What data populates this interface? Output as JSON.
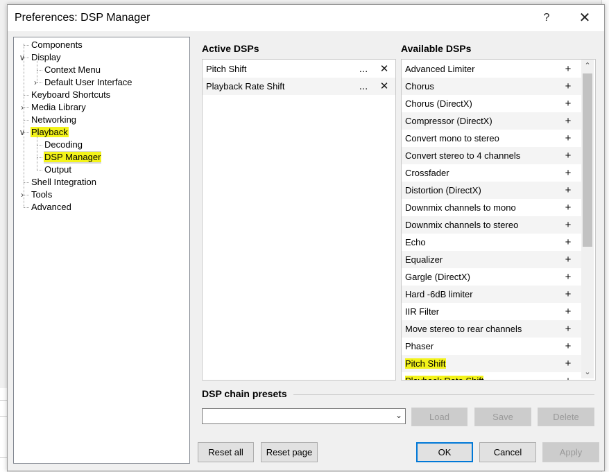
{
  "window": {
    "title": "Preferences: DSP Manager",
    "help_glyph": "?",
    "close_glyph": "✕"
  },
  "tree": {
    "items": [
      {
        "label": "Components",
        "highlight": false,
        "selected": false
      },
      {
        "label": "Display",
        "highlight": false,
        "selected": false,
        "expander": "expanded"
      },
      {
        "label": "Context Menu",
        "highlight": false,
        "selected": false
      },
      {
        "label": "Default User Interface",
        "highlight": false,
        "selected": false,
        "expander": "collapsed"
      },
      {
        "label": "Keyboard Shortcuts",
        "highlight": false,
        "selected": false
      },
      {
        "label": "Media Library",
        "highlight": false,
        "selected": false,
        "expander": "collapsed"
      },
      {
        "label": "Networking",
        "highlight": false,
        "selected": false
      },
      {
        "label": "Playback",
        "highlight": true,
        "selected": false,
        "expander": "expanded"
      },
      {
        "label": "Decoding",
        "highlight": false,
        "selected": false
      },
      {
        "label": "DSP Manager",
        "highlight": true,
        "selected": true
      },
      {
        "label": "Output",
        "highlight": false,
        "selected": false
      },
      {
        "label": "Shell Integration",
        "highlight": false,
        "selected": false
      },
      {
        "label": "Tools",
        "highlight": false,
        "selected": false,
        "expander": "collapsed"
      },
      {
        "label": "Advanced",
        "highlight": false,
        "selected": false
      }
    ]
  },
  "active": {
    "title": "Active DSPs",
    "configure_glyph": "...",
    "remove_glyph": "✕",
    "items": [
      {
        "label": "Pitch Shift"
      },
      {
        "label": "Playback Rate Shift"
      }
    ]
  },
  "available": {
    "title": "Available DSPs",
    "add_glyph": "+",
    "items": [
      {
        "label": "Advanced Limiter",
        "highlight": false
      },
      {
        "label": "Chorus",
        "highlight": false
      },
      {
        "label": "Chorus (DirectX)",
        "highlight": false
      },
      {
        "label": "Compressor (DirectX)",
        "highlight": false
      },
      {
        "label": "Convert mono to stereo",
        "highlight": false
      },
      {
        "label": "Convert stereo to 4 channels",
        "highlight": false
      },
      {
        "label": "Crossfader",
        "highlight": false
      },
      {
        "label": "Distortion (DirectX)",
        "highlight": false
      },
      {
        "label": "Downmix channels to mono",
        "highlight": false
      },
      {
        "label": "Downmix channels to stereo",
        "highlight": false
      },
      {
        "label": "Echo",
        "highlight": false
      },
      {
        "label": "Equalizer",
        "highlight": false
      },
      {
        "label": "Gargle (DirectX)",
        "highlight": false
      },
      {
        "label": "Hard -6dB limiter",
        "highlight": false
      },
      {
        "label": "IIR Filter",
        "highlight": false
      },
      {
        "label": "Move stereo to rear channels",
        "highlight": false
      },
      {
        "label": "Phaser",
        "highlight": false
      },
      {
        "label": "Pitch Shift",
        "highlight": true
      },
      {
        "label": "Playback Rate Shift",
        "highlight": true
      }
    ]
  },
  "presets": {
    "title": "DSP chain presets",
    "combo_value": "",
    "load_label": "Load",
    "save_label": "Save",
    "delete_label": "Delete"
  },
  "footer": {
    "reset_all_label": "Reset all",
    "reset_page_label": "Reset page",
    "ok_label": "OK",
    "cancel_label": "Cancel",
    "apply_label": "Apply"
  },
  "colors": {
    "highlight": "#f3f31a",
    "selection": "#d8d8d8",
    "default_button_border": "#0078d7"
  }
}
